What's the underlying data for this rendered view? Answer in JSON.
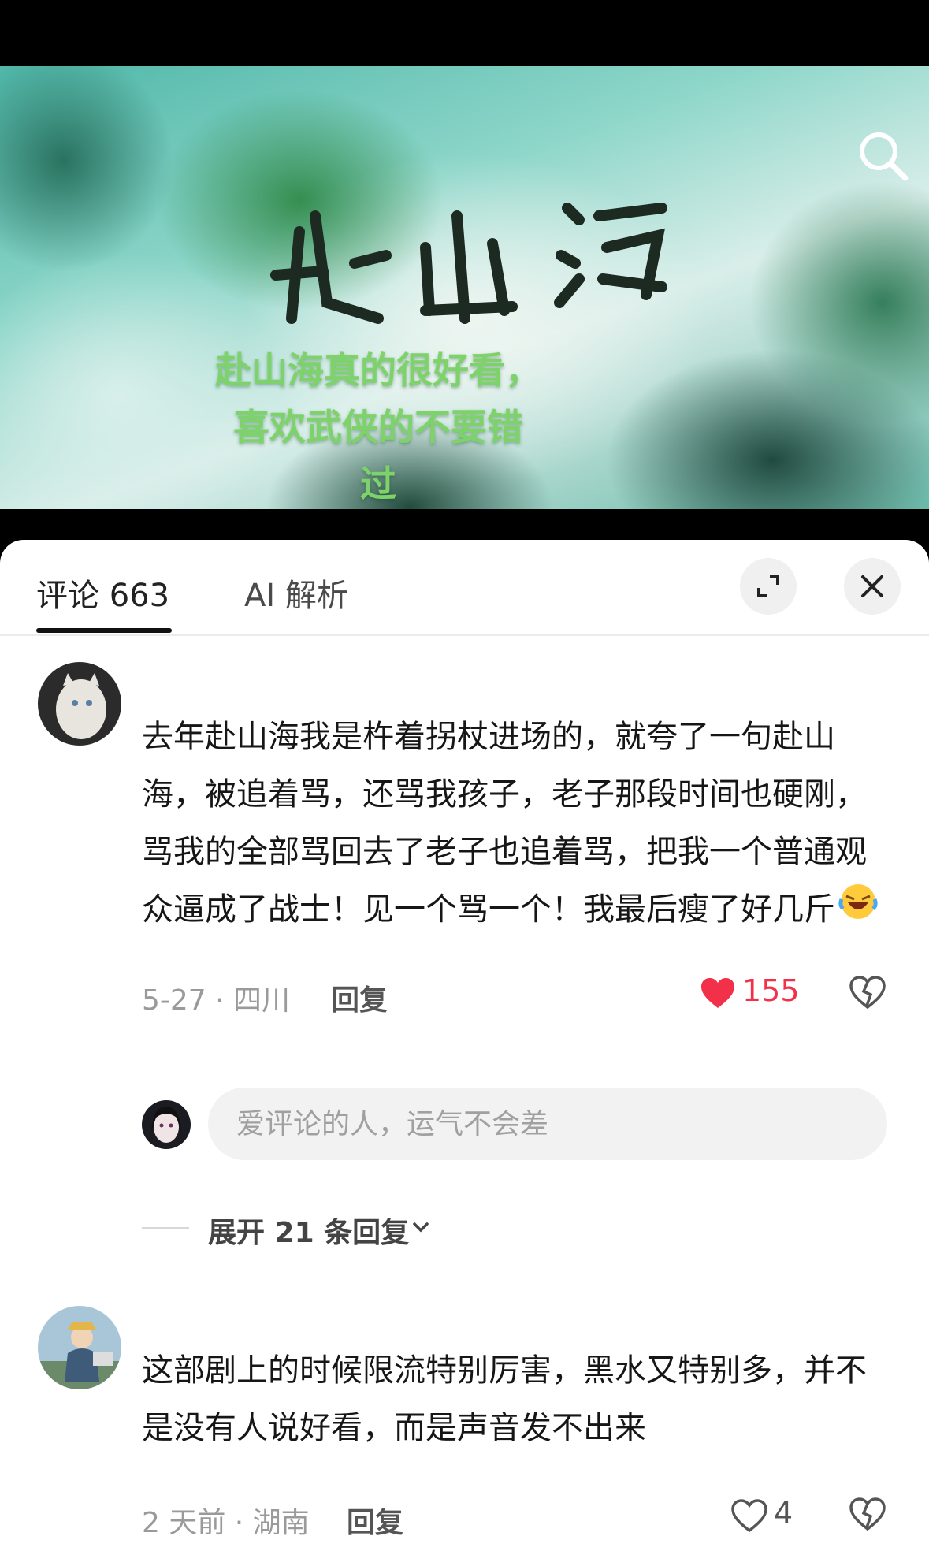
{
  "video": {
    "overlay_lines": [
      "赴山海真的很好看，",
      "喜欢武侠的不要错",
      "过"
    ],
    "overlay_emoji": "smiling-face-with-hearts-icon",
    "search_icon": "search-icon"
  },
  "tabs": {
    "comments_label": "评论 663",
    "ai_label": "AI 解析",
    "expand_icon": "expand-icon",
    "close_icon": "close-icon"
  },
  "comments": [
    {
      "text": "去年赴山海我是杵着拐杖进场的，就夸了一句赴山海，被追着骂，还骂我孩子，老子那段时间也硬刚，骂我的全部骂回去了老子也追着骂，把我一个普通观众逼成了战士！见一个骂一个！我最后瘦了好几斤",
      "emoji": "crying-laughing-face-icon",
      "meta": "5-27 · 四川",
      "reply_label": "回复",
      "likes": "155",
      "liked": true,
      "like_color": "#f2304a"
    },
    {
      "text": "这部剧上的时候限流特别厉害，黑水又特别多，并不是没有人说好看，而是声音发不出来",
      "meta": "2 天前 · 湖南",
      "reply_label": "回复",
      "likes": "4",
      "liked": false
    }
  ],
  "reply_box": {
    "placeholder": "爱评论的人，运气不会差"
  },
  "expand_replies_label": "展开 21 条回复"
}
